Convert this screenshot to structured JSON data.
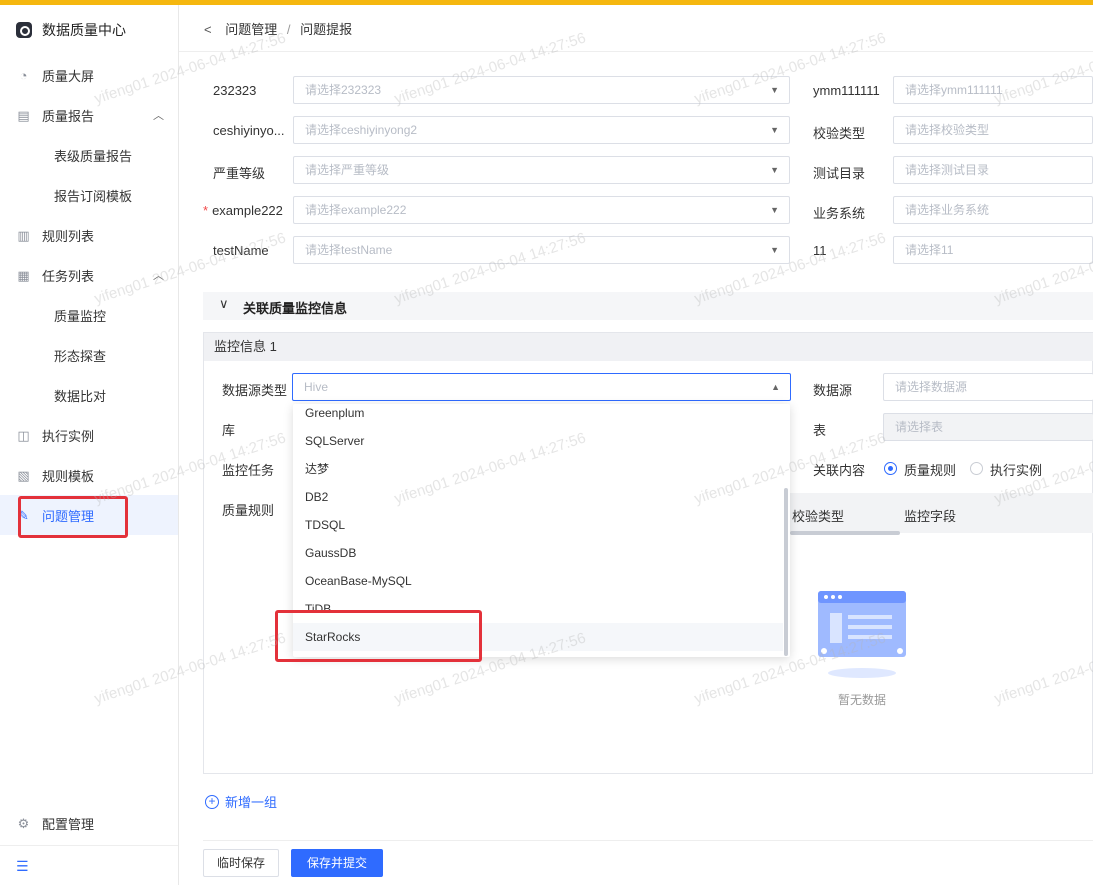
{
  "app": {
    "title": "数据质量中心"
  },
  "sidebar": {
    "items": [
      {
        "label": "质量大屏",
        "icon": "pie-chart-icon"
      },
      {
        "label": "质量报告",
        "icon": "report-icon",
        "expanded": true
      },
      {
        "label": "表级质量报告",
        "sub": true
      },
      {
        "label": "报告订阅模板",
        "sub": true
      },
      {
        "label": "规则列表",
        "icon": "list-icon"
      },
      {
        "label": "任务列表",
        "icon": "task-icon",
        "expanded": true
      },
      {
        "label": "质量监控",
        "sub": true
      },
      {
        "label": "形态探查",
        "sub": true
      },
      {
        "label": "数据比对",
        "sub": true
      },
      {
        "label": "执行实例",
        "icon": "instance-icon"
      },
      {
        "label": "规则模板",
        "icon": "template-icon"
      },
      {
        "label": "问题管理",
        "icon": "issue-icon",
        "active": true
      }
    ],
    "footer": {
      "label": "配置管理"
    }
  },
  "breadcrumb": {
    "back": "<",
    "parent": "问题管理",
    "sep": "/",
    "current": "问题提报"
  },
  "form": {
    "rows": [
      {
        "label": "232323",
        "placeholder": "请选择232323",
        "right_label": "ymm111111",
        "right_placeholder": "请选择ymm111111"
      },
      {
        "label": "ceshiyinyo...",
        "placeholder": "请选择ceshiyinyong2",
        "right_label": "校验类型",
        "right_placeholder": "请选择校验类型"
      },
      {
        "label": "严重等级",
        "placeholder": "请选择严重等级",
        "right_label": "测试目录",
        "right_placeholder": "请选择测试目录"
      },
      {
        "label": "example222",
        "placeholder": "请选择example222",
        "required": true,
        "right_label": "业务系统",
        "right_placeholder": "请选择业务系统"
      },
      {
        "label": "testName",
        "placeholder": "请选择testName",
        "right_label": "11",
        "right_placeholder": "请选择11"
      }
    ]
  },
  "section": {
    "title": "关联质量监控信息"
  },
  "monitor": {
    "header": "监控信息 1",
    "datasource_type_label": "数据源类型",
    "datasource_type_value": "Hive",
    "datasource_label": "数据源",
    "datasource_placeholder": "请选择数据源",
    "db_label": "库",
    "table_label": "表",
    "table_placeholder": "请选择表",
    "task_label": "监控任务",
    "related_label": "关联内容",
    "radio_rule": "质量规则",
    "radio_instance": "执行实例",
    "rule_label": "质量规则",
    "col_check_type": "校验类型",
    "col_field": "监控字段",
    "empty": "暂无数据"
  },
  "dropdown": {
    "options": [
      "Greenplum",
      "SQLServer",
      "达梦",
      "DB2",
      "TDSQL",
      "GaussDB",
      "OceanBase-MySQL",
      "TiDB",
      "StarRocks"
    ]
  },
  "actions": {
    "add_group": "新增一组",
    "temp_save": "临时保存",
    "save_submit": "保存并提交"
  },
  "watermark": "yifeng01 2024-06-04 14:27:56",
  "colors": {
    "accent": "#2f6bff",
    "topbar": "#f5b70f",
    "highlight": "#e3313a"
  }
}
